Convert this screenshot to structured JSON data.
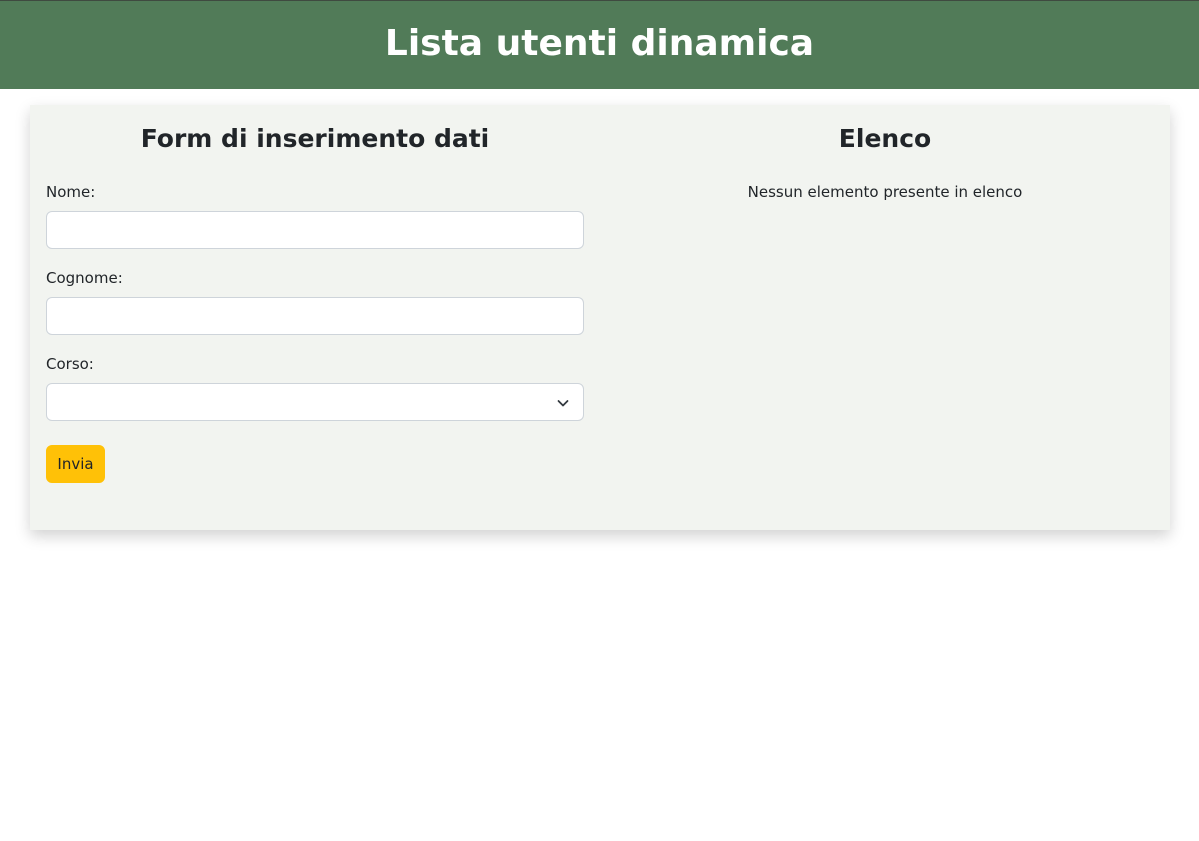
{
  "header": {
    "title": "Lista utenti dinamica"
  },
  "form": {
    "title": "Form di inserimento dati",
    "nome_label": "Nome:",
    "nome_value": "",
    "cognome_label": "Cognome:",
    "cognome_value": "",
    "corso_label": "Corso:",
    "corso_selected": "",
    "submit_label": "Invia"
  },
  "list": {
    "title": "Elenco",
    "empty_message": "Nessun elemento presente in elenco"
  },
  "colors": {
    "header_bg": "#517b58",
    "card_bg": "#f2f4f0",
    "submit_bg": "#ffc107"
  },
  "icons": {
    "select_arrow": "chevron-down-icon"
  }
}
